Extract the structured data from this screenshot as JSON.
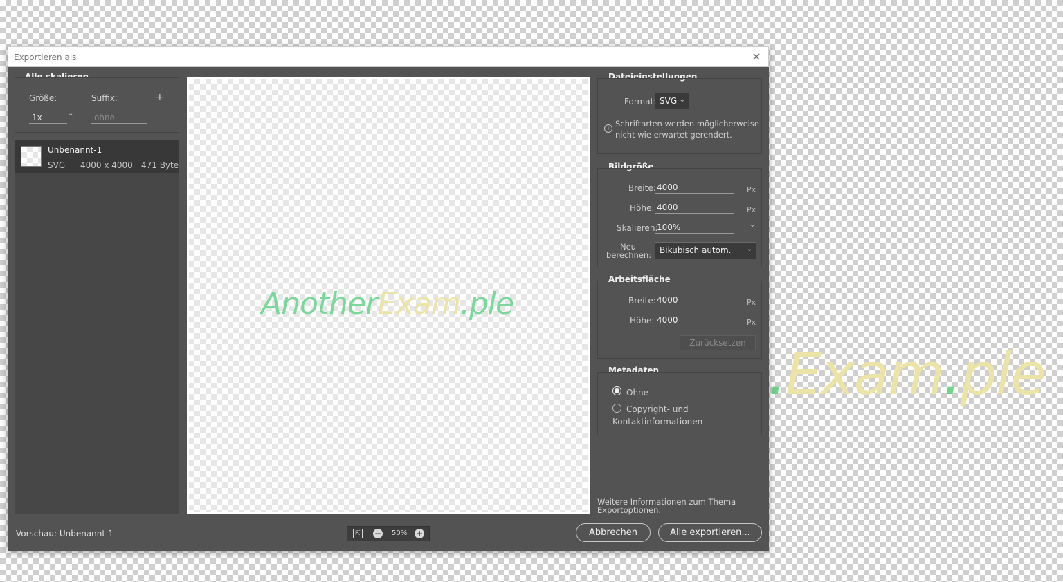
{
  "background": {
    "logo_part1": ".",
    "logo_part2": "Exam",
    "logo_part3": ".",
    "logo_part4": "ple"
  },
  "window": {
    "title": "Exportieren als",
    "close_icon": "×"
  },
  "scale_all": {
    "title": "Alle skalieren",
    "size_label": "Größe:",
    "suffix_label": "Suffix:",
    "add_icon": "+",
    "size_value": "1x",
    "suffix_placeholder": "ohne"
  },
  "asset": {
    "name": "Unbenannt-1",
    "format": "SVG",
    "dimensions": "4000 x 4000",
    "size": "471 Byte"
  },
  "preview": {
    "logo_part1": "Another",
    "logo_part2": "Exam",
    "logo_part3": ".ple"
  },
  "file_settings": {
    "title": "Dateieinstellungen",
    "format_label": "Format:",
    "format_value": "SVG",
    "info_text_1": "Schriftarten werden möglicherweise",
    "info_text_2": "nicht wie erwartet gerendert."
  },
  "image_size": {
    "title": "Bildgröße",
    "width_label": "Breite:",
    "width_value": "4000",
    "height_label": "Höhe:",
    "height_value": "4000",
    "scale_label": "Skalieren:",
    "scale_value": "100%",
    "unit": "Px",
    "resample_label_1": "Neu",
    "resample_label_2": "berechnen:",
    "resample_value": "Bikubisch autom."
  },
  "canvas": {
    "title": "Arbeitsfläche",
    "width_label": "Breite:",
    "width_value": "4000",
    "height_label": "Höhe:",
    "height_value": "4000",
    "unit": "Px",
    "reset_label": "Zurücksetzen"
  },
  "metadata": {
    "title": "Metadaten",
    "option_none": "Ohne",
    "option_copyright_1": "Copyright- und",
    "option_copyright_2": "Kontaktinformationen",
    "selected": "Ohne"
  },
  "more_info": {
    "text": "Weitere Informationen zum Thema",
    "link": "Exportoptionen."
  },
  "footer": {
    "preview_label": "Vorschau: Unbenannt-1",
    "zoom_value": "50%",
    "cancel_label": "Abbrechen",
    "export_label": "Alle exportieren..."
  }
}
